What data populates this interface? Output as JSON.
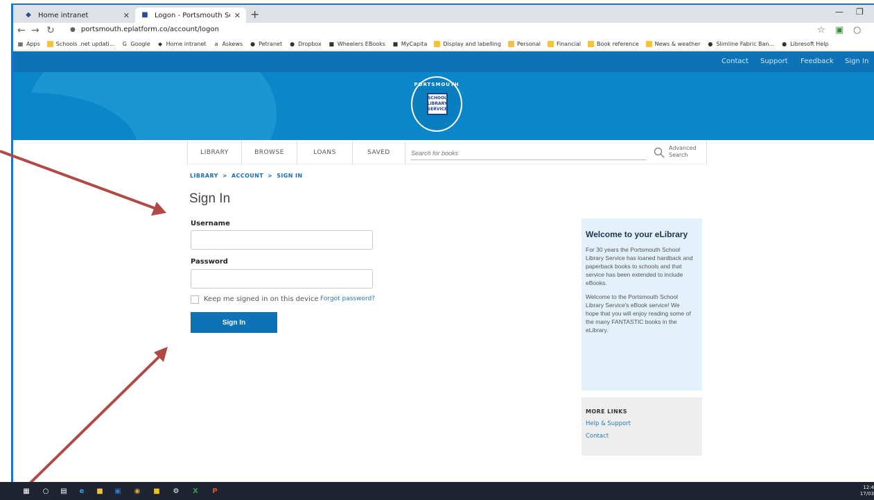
{
  "browser": {
    "tabs": [
      {
        "title": "Home intranet",
        "active": false
      },
      {
        "title": "Logon - Portsmouth Schools",
        "active": true
      }
    ],
    "url": "portsmouth.eplatform.co/account/logon",
    "bookmarks": [
      "Apps",
      "Schools .net updati...",
      "Google",
      "Home intranet",
      "Askews",
      "Petranet",
      "Dropbox",
      "Wheelers EBooks",
      "MyCapita",
      "Display and labelling",
      "Personal",
      "Financial",
      "Book reference",
      "News & weather",
      "Slimline Fabric Ban...",
      "Libresoft Help"
    ]
  },
  "site": {
    "top_links": {
      "contact": "Contact",
      "support": "Support",
      "feedback": "Feedback",
      "signin": "Sign In"
    },
    "logo": {
      "top": "PORTSMOUTH",
      "line1": "SCHOOL",
      "line2": "LIBRARY",
      "line3": "SERVICE"
    },
    "nav": {
      "library": "LIBRARY",
      "browse": "BROWSE",
      "loans": "LOANS",
      "saved": "SAVED"
    },
    "search": {
      "placeholder": "Search for books",
      "advanced_line1": "Advanced",
      "advanced_line2": "Search"
    }
  },
  "breadcrumb": [
    "LIBRARY",
    "ACCOUNT",
    "SIGN IN"
  ],
  "breadcrumb_sep": ">",
  "form": {
    "title": "Sign In",
    "username_label": "Username",
    "username_value": "",
    "password_label": "Password",
    "password_value": "",
    "keep_signed_in": "Keep me signed in on this device",
    "keep_checked": false,
    "forgot": "Forgot password?",
    "submit": "Sign In"
  },
  "welcome": {
    "heading": "Welcome to your eLibrary",
    "para1": "For 30 years the Portsmouth School Library Service has loaned hardback and paperback books to schools and that service has been extended to include eBooks.",
    "para2": "Welcome to the Portsmouth School Library Service's eBook service! We hope that you will enjoy reading some of the many FANTASTIC books in the eLibrary."
  },
  "more_links": {
    "heading": "MORE LINKS",
    "help": "Help & Support",
    "contact": "Contact"
  },
  "taskbar": {
    "time": "12:4",
    "date": "17/03"
  },
  "colors": {
    "brand": "#0e72b6",
    "hero": "#0a87c8",
    "arrow": "#b04a45",
    "panel": "#e3f1fb"
  }
}
